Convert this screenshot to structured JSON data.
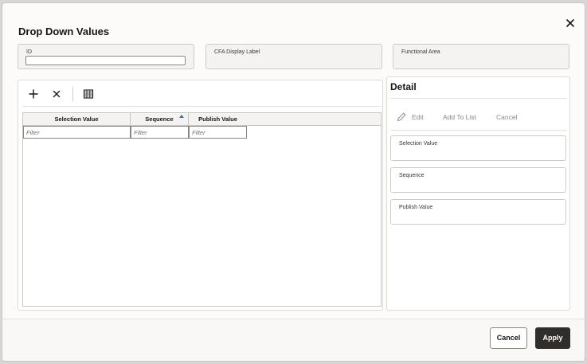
{
  "dialog": {
    "title": "Drop Down Values",
    "close_icon": "close-icon"
  },
  "fields": {
    "id_label": "ID",
    "cfa_label": "CFA Display Label",
    "functional_area_label": "Functional Area"
  },
  "toolbar": {
    "add_icon": "plus-icon",
    "delete_icon": "x-icon",
    "columns_icon": "table-icon"
  },
  "grid": {
    "columns": [
      {
        "label": "Selection Value",
        "filter_placeholder": "Filter"
      },
      {
        "label": "Sequence",
        "filter_placeholder": "Filter",
        "sort": "ascending"
      },
      {
        "label": "Publish Value",
        "filter_placeholder": "Filter"
      }
    ],
    "rows": []
  },
  "detail": {
    "title": "Detail",
    "actions": {
      "edit": "Edit",
      "add_to_list": "Add To List",
      "cancel": "Cancel"
    },
    "fields": [
      {
        "label": "Selection Value"
      },
      {
        "label": "Sequence"
      },
      {
        "label": "Publish Value"
      }
    ]
  },
  "footer": {
    "cancel_label": "Cancel",
    "apply_label": "Apply"
  },
  "colors": {
    "apply_bg": "#312d2a",
    "sort_arrow": "#3e6fa8",
    "disabled_text": "#8d8a85"
  }
}
